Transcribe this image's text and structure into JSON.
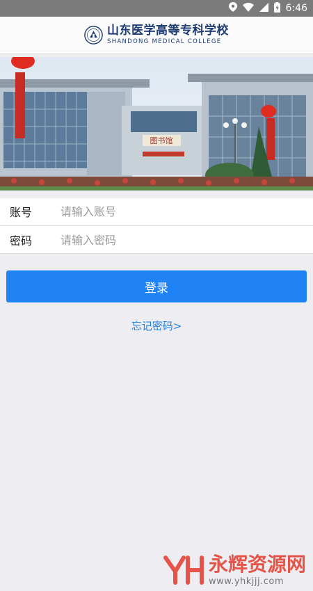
{
  "status_bar": {
    "time": "6:46",
    "icons": [
      "location-icon",
      "wifi-icon",
      "signal-icon",
      "battery-icon"
    ]
  },
  "header": {
    "title_cn": "山东医学高等专科学校",
    "title_en": "SHANDONG MEDICAL COLLEGE"
  },
  "banner": {
    "building_sign": "图书馆"
  },
  "form": {
    "account_label": "账号",
    "account_placeholder": "请输入账号",
    "password_label": "密码",
    "password_placeholder": "请输入密码"
  },
  "login_label": "登录",
  "forgot_label": "忘记密码>",
  "watermark": {
    "name": "永辉资源网",
    "url": "www.yhkjjj.com"
  },
  "colors": {
    "accent": "#1f83f6",
    "link": "#1f7fe0",
    "background": "#eeeef2"
  }
}
